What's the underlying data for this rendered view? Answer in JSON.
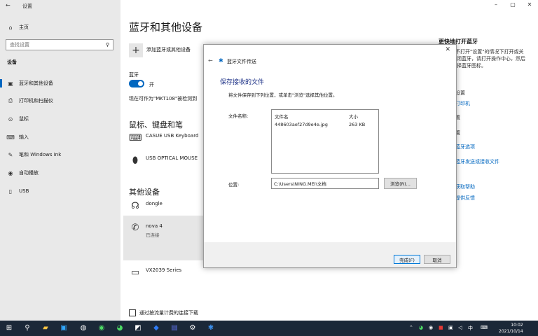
{
  "window": {
    "title": "设置",
    "minimize": "–",
    "maximize": "▢",
    "close": "✕"
  },
  "sidebar": {
    "home": "主页",
    "search_placeholder": "查找设置",
    "section": "设备",
    "items": [
      {
        "label": "蓝牙和其他设备",
        "icon": "bluetooth-icon"
      },
      {
        "label": "打印机和扫描仪",
        "icon": "printer-icon"
      },
      {
        "label": "鼠标",
        "icon": "mouse-icon"
      },
      {
        "label": "输入",
        "icon": "keyboard-icon"
      },
      {
        "label": "笔和 Windows Ink",
        "icon": "pen-icon"
      },
      {
        "label": "自动播放",
        "icon": "autoplay-icon"
      },
      {
        "label": "USB",
        "icon": "usb-icon"
      }
    ]
  },
  "main": {
    "title": "蓝牙和其他设备",
    "add_device": "添加蓝牙或其他设备",
    "bluetooth_label": "蓝牙",
    "bluetooth_state": "开",
    "discoverable": "现在可作为\"MKT108\"被检测到",
    "section_input": "鼠标、键盘和笔",
    "keyboard": "CASUE USB Keyboard",
    "mouse": "USB OPTICAL MOUSE",
    "section_other": "其他设备",
    "dongle": "dongle",
    "nova": "nova 4",
    "nova_status": "已连接",
    "monitor": "VX2039 Series",
    "metered": "通过按流量计费的连接下载"
  },
  "related": {
    "title": "更快地打开蓝牙",
    "text1": "不打开\"设置\"的情况下打开或关",
    "text2": "闭蓝牙，请打开操作中心，然后",
    "text3": "择蓝牙图标。",
    "frag_a": "设置",
    "link1": "打印机",
    "frag_b": "置",
    "frag_c": "置",
    "link2": "蓝牙选项",
    "link3": "蓝牙发送或接收文件",
    "link4": "获取帮助",
    "link5": "提供反馈"
  },
  "dialog": {
    "title": "蓝牙文件传送",
    "heading": "保存接收的文件",
    "instruction": "将文件保存到下列位置，或单击\"浏览\"选择其他位置。",
    "files_label": "文件名称:",
    "col_name": "文件名",
    "col_size": "大小",
    "file_name": "448603aef27d9e4e.jpg",
    "file_size": "263 KB",
    "location_label": "位置:",
    "location_value": "C:\\Users\\NING.MEI\\文档",
    "browse": "浏览(R)...",
    "finish": "完成(F)",
    "cancel": "取消"
  },
  "taskbar": {
    "time": "10:02",
    "date": "2021/10/14"
  },
  "colors": {
    "accent": "#0067c0",
    "sidebar_bg": "#e9e9e9",
    "taskbar_bg": "#1b2838",
    "dialog_heading": "#1e3287"
  }
}
